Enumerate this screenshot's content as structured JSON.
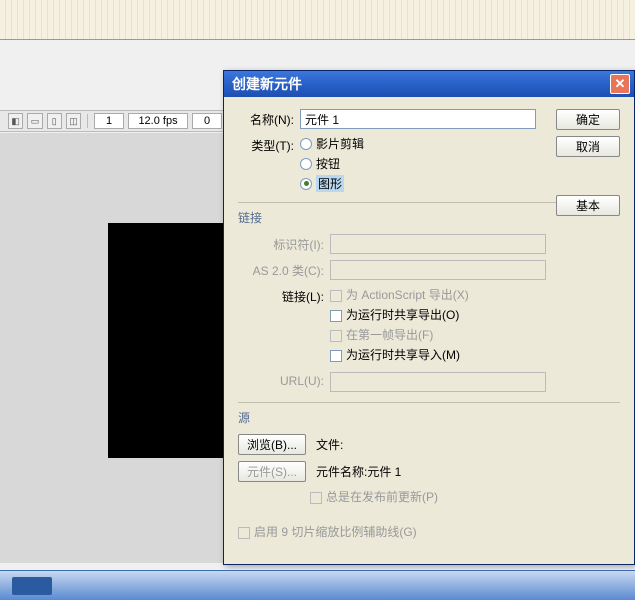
{
  "toolbar": {
    "frame": "1",
    "fps": "12.0 fps",
    "time": "0"
  },
  "dialog": {
    "title": "创建新元件",
    "name_label": "名称(N):",
    "name_value": "元件 1",
    "type_label": "类型(T):",
    "type_options": {
      "movieclip": "影片剪辑",
      "button": "按钮",
      "graphic": "图形"
    },
    "buttons": {
      "ok": "确定",
      "cancel": "取消",
      "basic": "基本"
    },
    "linkage": {
      "section": "链接",
      "identifier_label": "标识符(I):",
      "as2class_label": "AS 2.0 类(C):",
      "linkage_label": "链接(L):",
      "export_as": "为 ActionScript 导出(X)",
      "export_runtime": "为运行时共享导出(O)",
      "export_first": "在第一帧导出(F)",
      "import_runtime": "为运行时共享导入(M)",
      "url_label": "URL(U):"
    },
    "source": {
      "section": "源",
      "browse": "浏览(B)...",
      "file_label": "文件:",
      "symbol_btn": "元件(S)...",
      "symbol_label": "元件名称:元件 1",
      "always_update": "总是在发布前更新(P)"
    },
    "scale9": "启用 9 切片缩放比例辅助线(G)"
  }
}
